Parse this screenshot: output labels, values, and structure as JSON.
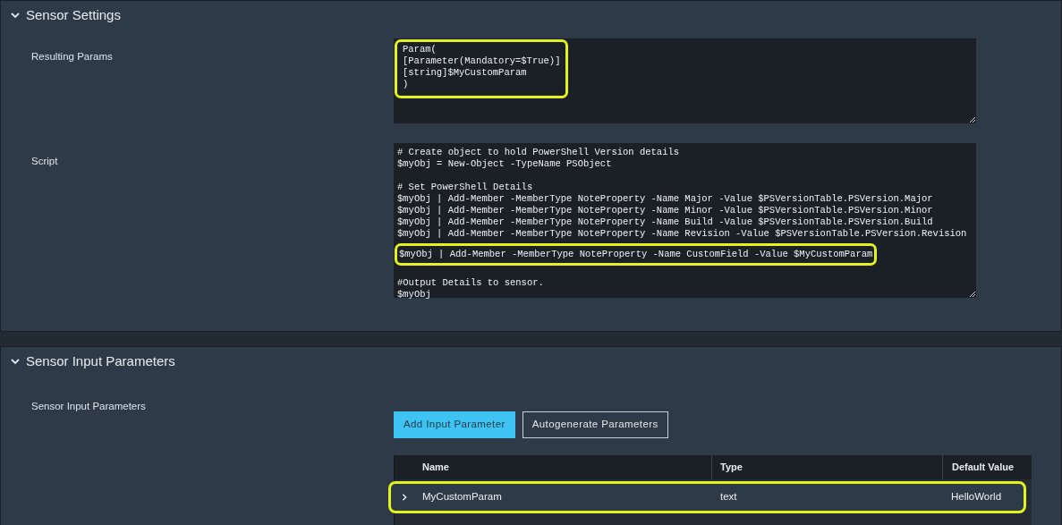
{
  "sections": [
    {
      "title": "Sensor Settings",
      "expanded": true,
      "fields": [
        {
          "kind": "code",
          "label": "Resulting Params",
          "blocks": [
            {
              "highlighted": true,
              "lines": [
                "Param(",
                "[Parameter(Mandatory=$True)]",
                "[string]$MyCustomParam",
                ")"
              ]
            }
          ]
        },
        {
          "kind": "script",
          "label": "Script",
          "blocks": [
            {
              "highlighted": false,
              "lines": [
                "# Create object to hold PowerShell Version details",
                "$myObj = New-Object -TypeName PSObject"
              ]
            },
            {
              "highlighted": false,
              "lines": [
                "# Set PowerShell Details",
                "$myObj | Add-Member -MemberType NoteProperty -Name Major -Value $PSVersionTable.PSVersion.Major",
                "$myObj | Add-Member -MemberType NoteProperty -Name Minor -Value $PSVersionTable.PSVersion.Minor",
                "$myObj | Add-Member -MemberType NoteProperty -Name Build -Value $PSVersionTable.PSVersion.Build",
                "$myObj | Add-Member -MemberType NoteProperty -Name Revision -Value $PSVersionTable.PSVersion.Revision"
              ]
            },
            {
              "highlighted": true,
              "lines": [
                "$myObj | Add-Member -MemberType NoteProperty -Name CustomField -Value $MyCustomParam"
              ]
            },
            {
              "highlighted": false,
              "lines": [
                "#Output Details to sensor.",
                "$myObj"
              ]
            }
          ]
        }
      ]
    },
    {
      "title": "Sensor Input Parameters",
      "expanded": true,
      "fields": [
        {
          "kind": "parameters",
          "label": "Sensor Input Parameters",
          "buttons": [
            {
              "label": "Add Input Parameter",
              "primary": true
            },
            {
              "label": "Autogenerate Parameters",
              "primary": false
            }
          ],
          "table": {
            "columns": [
              "Name",
              "Type",
              "Default Value"
            ],
            "rows": [
              {
                "expanded": false,
                "highlighted": true,
                "cells": [
                  "MyCustomParam",
                  "text",
                  "HelloWorld"
                ]
              }
            ]
          }
        }
      ]
    }
  ]
}
